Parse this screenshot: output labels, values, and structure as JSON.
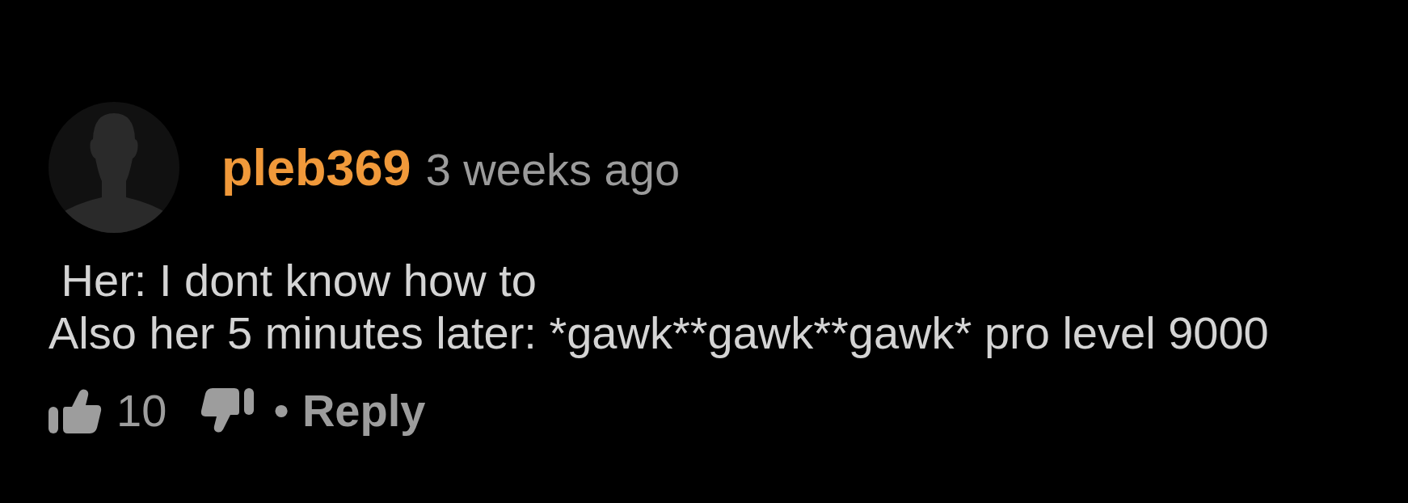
{
  "comment": {
    "author": "pleb369",
    "time": "3 weeks ago",
    "body": " Her: I dont know how to\nAlso her 5 minutes later: *gawk**gawk**gawk* pro level 9000",
    "likes": "10",
    "separator": "•",
    "reply": "Reply"
  }
}
